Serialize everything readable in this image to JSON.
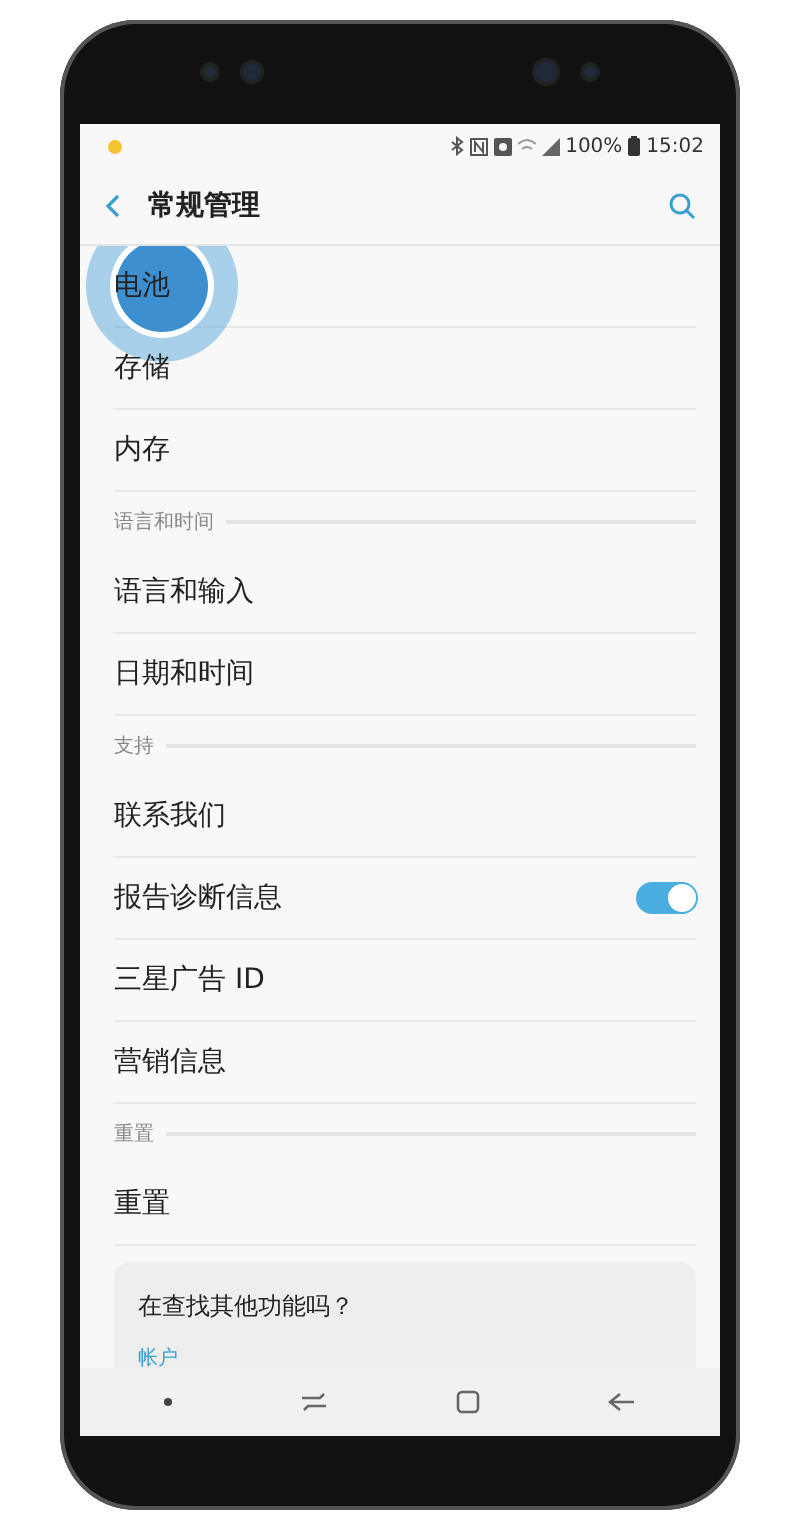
{
  "status_bar": {
    "notification_dot": true,
    "battery": "100%",
    "time": "15:02"
  },
  "header": {
    "title": "常规管理"
  },
  "items": [
    {
      "kind": "row",
      "label": "电池",
      "touched": true
    },
    {
      "kind": "row",
      "label": "存储",
      "touched": false
    },
    {
      "kind": "row",
      "label": "内存",
      "touched": false
    },
    {
      "kind": "section",
      "label": "语言和时间"
    },
    {
      "kind": "row",
      "label": "语言和输入",
      "touched": false
    },
    {
      "kind": "row",
      "label": "日期和时间",
      "touched": false
    },
    {
      "kind": "section",
      "label": "支持"
    },
    {
      "kind": "row",
      "label": "联系我们",
      "touched": false
    },
    {
      "kind": "toggle",
      "label": "报告诊断信息",
      "on": true
    },
    {
      "kind": "row",
      "label": "三星广告 ID",
      "touched": false
    },
    {
      "kind": "row",
      "label": "营销信息",
      "touched": false
    },
    {
      "kind": "section",
      "label": "重置"
    },
    {
      "kind": "row",
      "label": "重置",
      "touched": false
    }
  ],
  "suggestion_card": {
    "title": "在查找其他功能吗？",
    "link": "帐户"
  }
}
